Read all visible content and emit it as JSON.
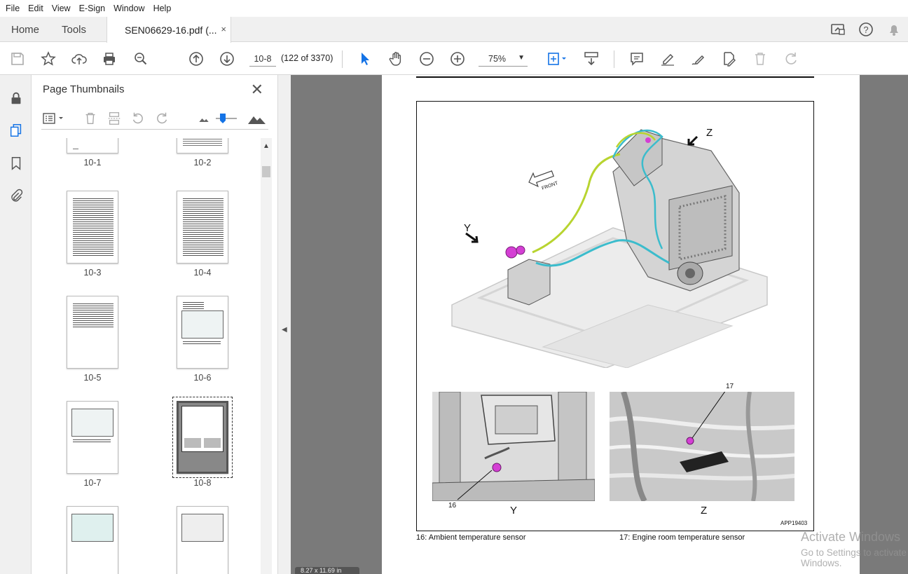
{
  "menu": [
    "File",
    "Edit",
    "View",
    "E-Sign",
    "Window",
    "Help"
  ],
  "tabs": {
    "home": "Home",
    "tools": "Tools",
    "document": "SEN06629-16.pdf (...",
    "close": "×"
  },
  "toolbar": {
    "page_value": "10-8",
    "page_count": "(122 of 3370)",
    "zoom": "75%",
    "accent_color": "#1473e6"
  },
  "thumbnails": {
    "title": "Page Thumbnails",
    "close": "✕",
    "items": [
      {
        "label": "10-1"
      },
      {
        "label": "10-2"
      },
      {
        "label": "10-3"
      },
      {
        "label": "10-4"
      },
      {
        "label": "10-5"
      },
      {
        "label": "10-6"
      },
      {
        "label": "10-7"
      },
      {
        "label": "10-8",
        "selected": true
      },
      {
        "label": ""
      },
      {
        "label": ""
      }
    ]
  },
  "document": {
    "figure_labels": {
      "y_arrow": "Y",
      "z_arrow": "Z",
      "front": "FRONT",
      "photo_y": "Y",
      "photo_z": "Z",
      "callout_16": "16",
      "callout_17": "17",
      "figure_id": "APP19403"
    },
    "captions": {
      "left": "16: Ambient temperature sensor",
      "right": "17: Engine room temperature sensor"
    }
  },
  "watermark": {
    "line1": "Activate Windows",
    "line2": "Go to Settings to activate Windows."
  },
  "page_size": "8.27 x 11.69 in"
}
